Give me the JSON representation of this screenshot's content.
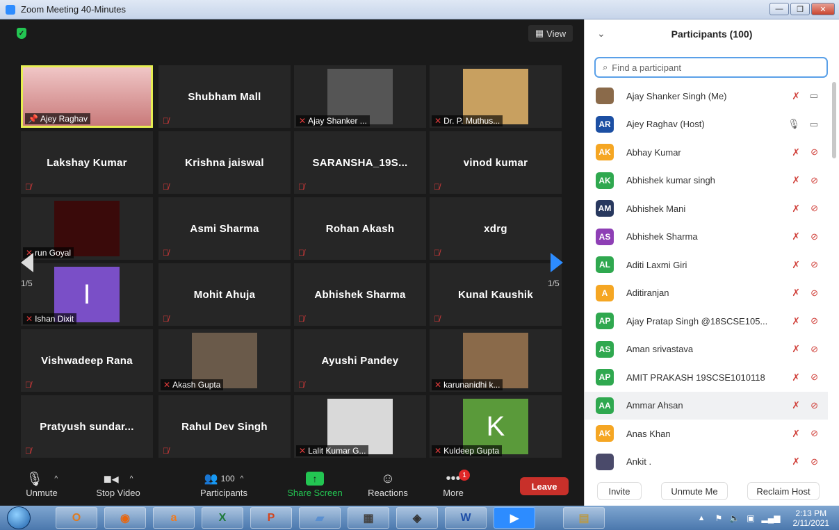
{
  "window": {
    "title": "Zoom Meeting 40-Minutes"
  },
  "meeting": {
    "view_label": "View",
    "page_left": "1/5",
    "page_right": "1/5"
  },
  "tiles": [
    {
      "name": "",
      "label": "Ajey Raghav",
      "pinned": true
    },
    {
      "name": "Shubham Mall"
    },
    {
      "name": "",
      "label": "Ajay Shanker ..."
    },
    {
      "name": "",
      "label": "Dr. P. Muthus..."
    },
    {
      "name": "Lakshay Kumar"
    },
    {
      "name": "Krishna jaiswal"
    },
    {
      "name": "SARANSHA_19S..."
    },
    {
      "name": "vinod kumar"
    },
    {
      "name": "",
      "label": "run Goyal"
    },
    {
      "name": "Asmi Sharma"
    },
    {
      "name": "Rohan Akash"
    },
    {
      "name": "xdrg"
    },
    {
      "name": "",
      "label": "Ishan Dixit",
      "initial": "I"
    },
    {
      "name": "Mohit Ahuja"
    },
    {
      "name": "Abhishek Sharma"
    },
    {
      "name": "Kunal Kaushik"
    },
    {
      "name": "Vishwadeep Rana"
    },
    {
      "name": "",
      "label": "Akash Gupta"
    },
    {
      "name": "Ayushi Pandey"
    },
    {
      "name": "",
      "label": "karunanidhi k..."
    },
    {
      "name": "Pratyush  sundar..."
    },
    {
      "name": "Rahul Dev Singh"
    },
    {
      "name": "",
      "label": "Lalit Kumar G..."
    },
    {
      "name": "",
      "label": "Kuldeep Gupta",
      "initial": "K"
    }
  ],
  "toolbar": {
    "unmute": "Unmute",
    "stop_video": "Stop Video",
    "participants": "Participants",
    "participants_count": "100",
    "share": "Share Screen",
    "reactions": "Reactions",
    "more": "More",
    "more_badge": "1",
    "leave": "Leave"
  },
  "panel": {
    "title": "Participants (100)",
    "search_placeholder": "Find a participant",
    "participants": [
      {
        "avatar": "",
        "name": "Ajay Shanker Singh (Me)",
        "color": "#8a6a4a",
        "photo": true
      },
      {
        "avatar": "AR",
        "name": "Ajey Raghav (Host)",
        "color": "#1c4fa3",
        "mic_on": true
      },
      {
        "avatar": "AK",
        "name": "Abhay Kumar",
        "color": "#f5a623"
      },
      {
        "avatar": "AK",
        "name": "Abhishek kumar singh",
        "color": "#2fa84f"
      },
      {
        "avatar": "AM",
        "name": "Abhishek Mani",
        "color": "#28385e"
      },
      {
        "avatar": "AS",
        "name": "Abhishek Sharma",
        "color": "#8e3fb5"
      },
      {
        "avatar": "AL",
        "name": "Aditi Laxmi Giri",
        "color": "#2fa84f"
      },
      {
        "avatar": "A",
        "name": "Aditiranjan",
        "color": "#f5a623"
      },
      {
        "avatar": "AP",
        "name": "Ajay Pratap Singh @18SCSE105...",
        "color": "#2fa84f"
      },
      {
        "avatar": "AS",
        "name": "Aman srivastava",
        "color": "#2fa84f"
      },
      {
        "avatar": "AP",
        "name": "AMIT PRAKASH 19SCSE1010118",
        "color": "#2fa84f"
      },
      {
        "avatar": "AA",
        "name": "Ammar Ahsan",
        "color": "#2fa84f",
        "highlight": true
      },
      {
        "avatar": "AK",
        "name": "Anas Khan",
        "color": "#f5a623"
      },
      {
        "avatar": "",
        "name": "Ankit .",
        "color": "#4a4a6a",
        "photo": true
      }
    ],
    "invite": "Invite",
    "unmute_me": "Unmute Me",
    "reclaim_host": "Reclaim Host"
  },
  "taskbar": {
    "time": "2:13 PM",
    "date": "2/11/2021"
  }
}
